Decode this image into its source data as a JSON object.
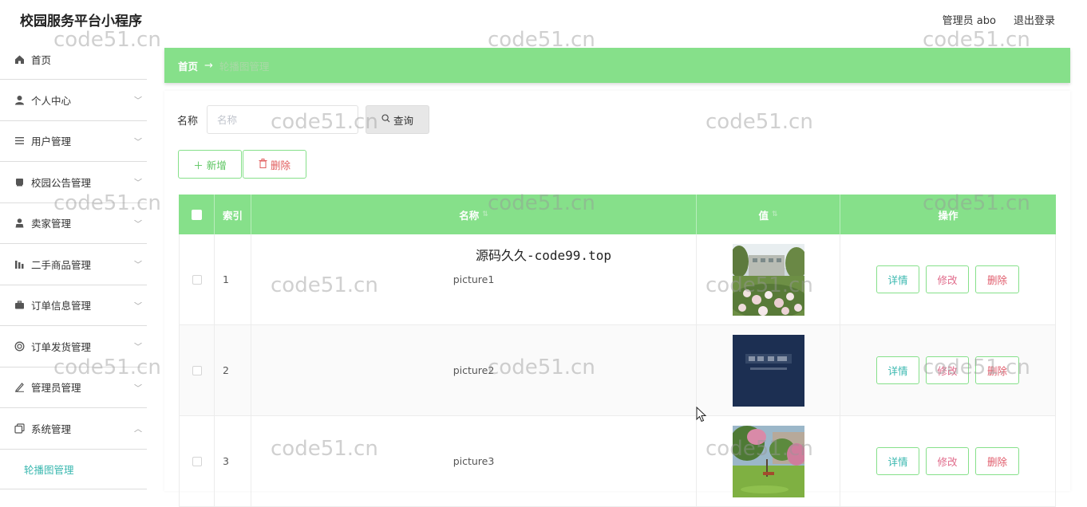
{
  "app": {
    "title": "校园服务平台小程序"
  },
  "header": {
    "user_label": "管理员 abo",
    "logout_label": "退出登录"
  },
  "sidebar": {
    "items": [
      {
        "label": "首页",
        "icon": "home-icon",
        "expandable": false
      },
      {
        "label": "个人中心",
        "icon": "person-icon",
        "expandable": true
      },
      {
        "label": "用户管理",
        "icon": "list-icon",
        "expandable": true
      },
      {
        "label": "校园公告管理",
        "icon": "notice-icon",
        "expandable": true
      },
      {
        "label": "卖家管理",
        "icon": "seller-icon",
        "expandable": true
      },
      {
        "label": "二手商品管理",
        "icon": "chart-icon",
        "expandable": true
      },
      {
        "label": "订单信息管理",
        "icon": "briefcase-icon",
        "expandable": true
      },
      {
        "label": "订单发货管理",
        "icon": "circle-icon",
        "expandable": true
      },
      {
        "label": "管理员管理",
        "icon": "pen-icon",
        "expandable": true
      },
      {
        "label": "系统管理",
        "icon": "copy-icon",
        "expandable": true,
        "expanded": true
      }
    ],
    "sub_item": "轮播图管理"
  },
  "breadcrumb": {
    "home": "首页",
    "separator": "→",
    "current": "轮播图管理"
  },
  "search": {
    "label": "名称",
    "placeholder": "名称",
    "button": "查询"
  },
  "actions": {
    "add": "＋ 新增",
    "delete": "删除"
  },
  "table": {
    "columns": {
      "index": "索引",
      "name": "名称",
      "value": "值",
      "operation": "操作"
    },
    "rows": [
      {
        "index": "1",
        "name": "picture1",
        "image": "campus-garden"
      },
      {
        "index": "2",
        "name": "picture2",
        "image": "dark-blue-sign"
      },
      {
        "index": "3",
        "name": "picture3",
        "image": "campus-park"
      }
    ],
    "row_buttons": {
      "detail": "详情",
      "edit": "修改",
      "delete": "删除"
    }
  },
  "overlay_text": "源码久久-code99.top",
  "watermark": "code51.cn",
  "colors": {
    "accent": "#86e08a",
    "teal": "#3bb8b0",
    "danger": "#e05b6b"
  }
}
